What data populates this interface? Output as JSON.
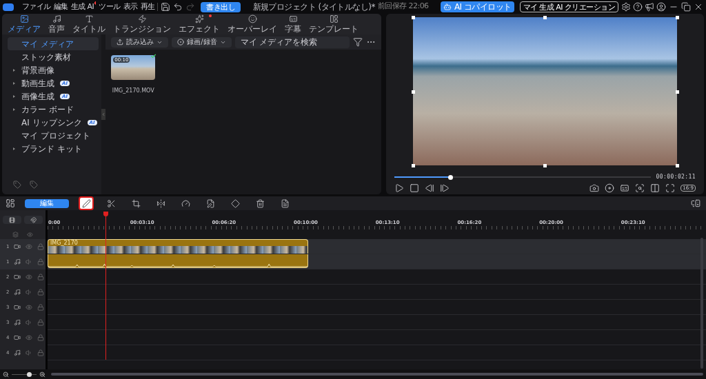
{
  "title_bar": {
    "menu": [
      {
        "label": "ファイル",
        "badge": false
      },
      {
        "label": "編集",
        "badge": false
      },
      {
        "label": "生成 AI",
        "badge": true
      },
      {
        "label": "ツール",
        "badge": false
      },
      {
        "label": "表示",
        "badge": false
      },
      {
        "label": "再生",
        "badge": false
      }
    ],
    "export_button": "書き出し",
    "project_title": "新規プロジェクト (タイトルなし)*",
    "last_saved": "前回保存 22:06",
    "copilot_button": "AI コパイロット",
    "creations_button": "マイ 生成 AI クリエーション"
  },
  "media_tabs": [
    {
      "label": "メディア",
      "kind": "media",
      "selected": true,
      "badge": false
    },
    {
      "label": "音声",
      "kind": "audio",
      "selected": false,
      "badge": false
    },
    {
      "label": "タイトル",
      "kind": "title",
      "selected": false,
      "badge": false
    },
    {
      "label": "トランジション",
      "kind": "transition",
      "selected": false,
      "badge": false
    },
    {
      "label": "エフェクト",
      "kind": "effect",
      "selected": false,
      "badge": true
    },
    {
      "label": "オーバーレイ",
      "kind": "overlay",
      "selected": false,
      "badge": false
    },
    {
      "label": "字幕",
      "kind": "subtitle",
      "selected": false,
      "badge": false
    },
    {
      "label": "テンプレート",
      "kind": "template",
      "selected": false,
      "badge": false
    }
  ],
  "sidebar": {
    "items": [
      {
        "label": "マイ メディア",
        "selected": true,
        "expandable": false
      },
      {
        "label": "ストック素材",
        "selected": false,
        "expandable": false
      },
      {
        "label": "背景画像",
        "selected": false,
        "expandable": true
      },
      {
        "label": "動画生成",
        "selected": false,
        "expandable": true,
        "badge": "AI"
      },
      {
        "label": "画像生成",
        "selected": false,
        "expandable": true,
        "badge": "AI"
      },
      {
        "label": "カラー ボード",
        "selected": false,
        "expandable": true
      },
      {
        "label": "AI リップシンク",
        "selected": false,
        "expandable": false,
        "badge": "AI"
      },
      {
        "label": "マイ プロジェクト",
        "selected": false,
        "expandable": false
      },
      {
        "label": "ブランド キット",
        "selected": false,
        "expandable": true
      }
    ]
  },
  "media_toolbar": {
    "import_button": "読み込み",
    "record_button": "録画/録音",
    "search_placeholder": "マイ メディアを検索"
  },
  "media_items": [
    {
      "duration": "00:10",
      "name": "IMG_2170.MOV",
      "checked": true
    }
  ],
  "preview": {
    "level": 0.22,
    "timecode": "00:00:02:11",
    "aspect_button": "16:9"
  },
  "timeline_toolbar": {
    "edit_button": "編集",
    "tools": [
      {
        "kind": "pen",
        "highlighted": true
      },
      {
        "kind": "scissors",
        "highlighted": false
      },
      {
        "kind": "crop",
        "highlighted": false
      },
      {
        "kind": "flip",
        "highlighted": false
      },
      {
        "kind": "speed",
        "highlighted": false
      },
      {
        "kind": "file-edit",
        "highlighted": false
      },
      {
        "kind": "keyframe",
        "highlighted": false
      },
      {
        "kind": "trash",
        "highlighted": false
      },
      {
        "kind": "report",
        "highlighted": false
      }
    ]
  },
  "ruler": [
    "0:00",
    "00:03:10",
    "00:06:20",
    "00:10:00",
    "00:13:10",
    "00:16:20",
    "00:20:00",
    "00:23:10"
  ],
  "tracks": [
    {
      "number": "1",
      "kind": "video",
      "clip": "IMG_2170"
    },
    {
      "number": "1",
      "kind": "audio",
      "has_clip": true
    },
    {
      "number": "2",
      "kind": "video"
    },
    {
      "number": "2",
      "kind": "audio",
      "has_clip": false
    },
    {
      "number": "3",
      "kind": "video"
    },
    {
      "number": "3",
      "kind": "audio",
      "has_clip": false
    },
    {
      "number": "4",
      "kind": "video"
    },
    {
      "number": "4",
      "kind": "audio",
      "has_clip": false
    }
  ],
  "zoom": {
    "level": 0.7
  }
}
